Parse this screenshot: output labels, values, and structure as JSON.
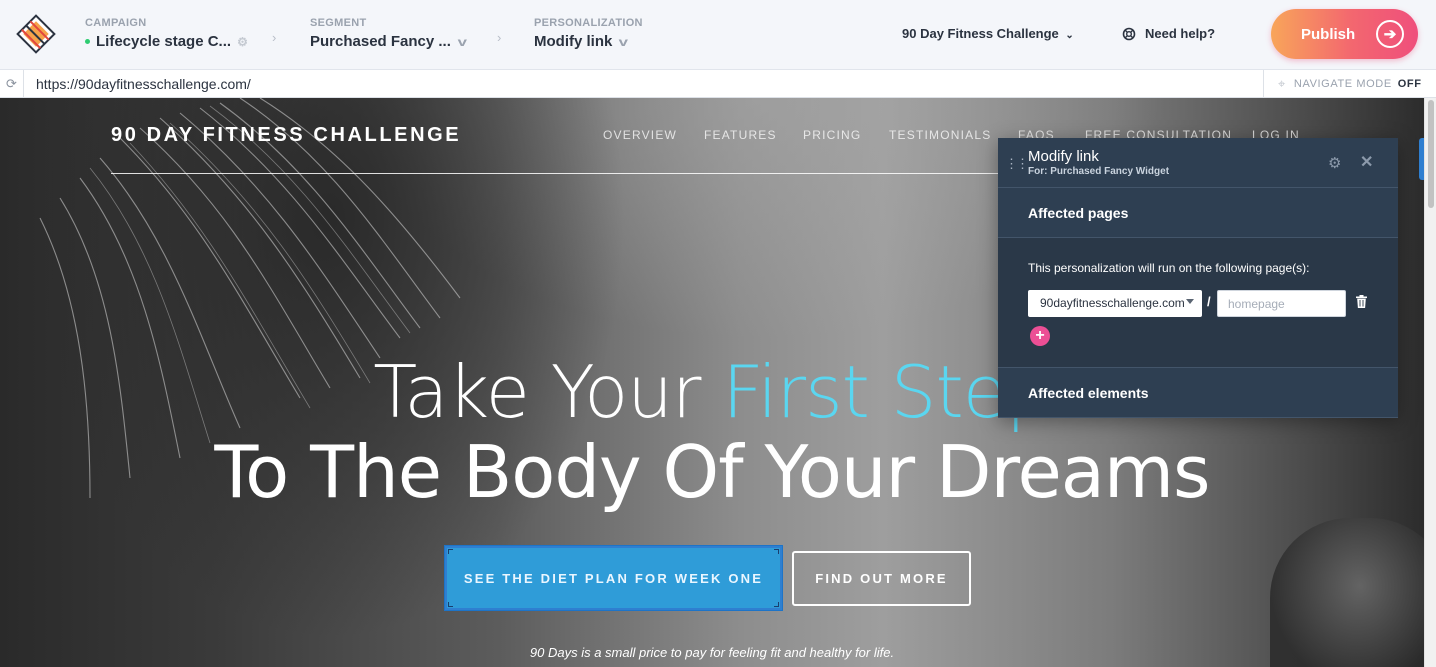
{
  "header": {
    "crumbs": [
      {
        "label": "CAMPAIGN",
        "value": "Lifecycle stage C..."
      },
      {
        "label": "SEGMENT",
        "value": "Purchased Fancy ..."
      },
      {
        "label": "PERSONALIZATION",
        "value": "Modify link"
      }
    ],
    "site_selector": "90 Day Fitness Challenge",
    "help": "Need help?",
    "publish": "Publish"
  },
  "urlbar": {
    "url": "https://90dayfitnesschallenge.com/",
    "navigate_mode_label": "NAVIGATE MODE",
    "navigate_mode_state": "OFF"
  },
  "site": {
    "brand": "90 DAY FITNESS CHALLENGE",
    "nav": [
      "OVERVIEW",
      "FEATURES",
      "PRICING",
      "TESTIMONIALS",
      "FAQS",
      "FREE CONSULTATION",
      "LOG IN"
    ],
    "hero_line1_start": "Take Your ",
    "hero_line1_accent": "First Step",
    "hero_line2": "To The Body Of Your Dreams",
    "cta_primary": "SEE THE DIET PLAN FOR WEEK ONE",
    "cta_secondary": "FIND OUT MORE",
    "tagline": "90 Days is a small price to pay for feeling fit and healthy for life."
  },
  "panel": {
    "title": "Modify link",
    "subtitle": "For: Purchased Fancy Widget",
    "section_pages": "Affected pages",
    "pages_desc": "This personalization will run on the following page(s):",
    "domain": "90dayfitnesschallenge.com",
    "path_placeholder": "homepage",
    "section_elements": "Affected elements"
  },
  "colors": {
    "accent_cyan": "#5ad6f0",
    "publish_gradient_start": "#f8a55a",
    "publish_gradient_end": "#ef4f7c",
    "panel_bg": "#2e3f52",
    "add_button": "#ec4f95",
    "cta_blue": "#2f9cd8"
  },
  "icons": [
    "logo-icon",
    "gear-icon",
    "chevron-down-icon",
    "help-icon",
    "arrow-right-icon",
    "reload-icon",
    "crosshair-icon",
    "drag-handle-icon",
    "close-icon",
    "trash-icon",
    "plus-icon"
  ]
}
